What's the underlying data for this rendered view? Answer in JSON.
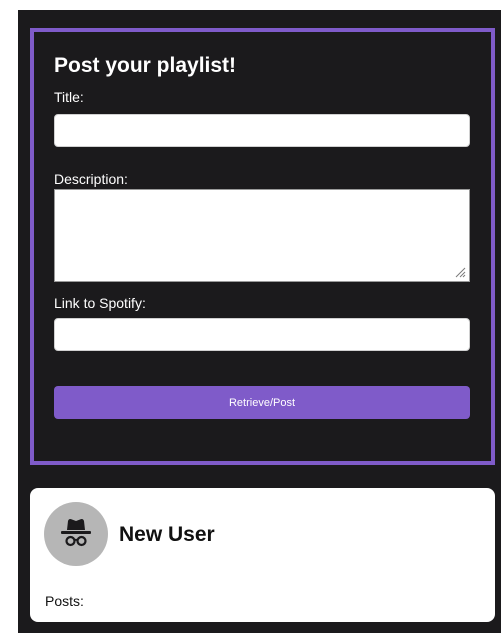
{
  "post_form": {
    "heading": "Post your playlist!",
    "title_label": "Title:",
    "title_value": "",
    "description_label": "Description:",
    "description_value": "",
    "link_label": "Link to Spotify:",
    "link_value": "",
    "submit_label": "Retrieve/Post"
  },
  "user_card": {
    "avatar_icon": "incognito-icon",
    "name": "New User",
    "posts_label": "Posts:"
  },
  "colors": {
    "accent": "#7f5bc9",
    "background": "#1b1a1c",
    "card": "#ffffff",
    "avatar_bg": "#b6b6b6"
  }
}
